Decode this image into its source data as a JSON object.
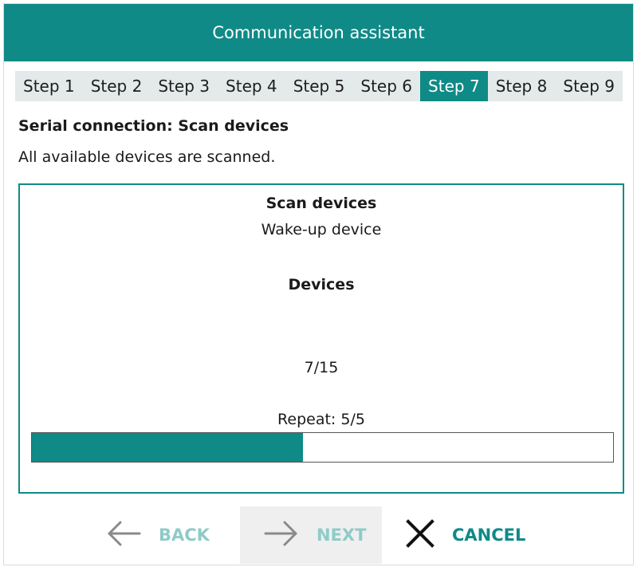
{
  "window": {
    "title": "Communication assistant"
  },
  "steps": [
    {
      "label": "Step 1",
      "active": false
    },
    {
      "label": "Step 2",
      "active": false
    },
    {
      "label": "Step 3",
      "active": false
    },
    {
      "label": "Step 4",
      "active": false
    },
    {
      "label": "Step 5",
      "active": false
    },
    {
      "label": "Step 6",
      "active": false
    },
    {
      "label": "Step 7",
      "active": true
    },
    {
      "label": "Step 8",
      "active": false
    },
    {
      "label": "Step 9",
      "active": false
    }
  ],
  "page": {
    "heading": "Serial connection: Scan devices",
    "description": "All available devices are scanned."
  },
  "scan": {
    "title": "Scan devices",
    "status": "Wake-up device",
    "devices_label": "Devices",
    "device_count": "7/15",
    "repeat_text": "Repeat: 5/5",
    "progress_fraction": 0.467
  },
  "footer": {
    "back_label": "BACK",
    "next_label": "NEXT",
    "cancel_label": "CANCEL"
  },
  "colors": {
    "accent": "#0f8a87",
    "disabled_text": "#8fcbc8",
    "step_bar_bg": "#e4e9ea"
  },
  "icons": {
    "back": "arrow-left-icon",
    "next": "arrow-right-icon",
    "cancel": "close-x-icon"
  }
}
